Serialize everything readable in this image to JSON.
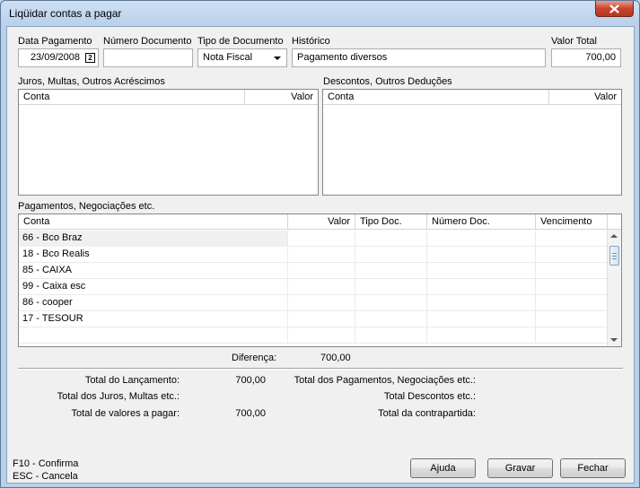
{
  "window": {
    "title": "Liqüidar contas a pagar"
  },
  "header": {
    "data_pagamento_label": "Data Pagamento",
    "data_pagamento_value": "23/09/2008",
    "numero_documento_label": "Número Documento",
    "numero_documento_value": "",
    "tipo_documento_label": "Tipo de Documento",
    "tipo_documento_value": "Nota Fiscal",
    "historico_label": "Histórico",
    "historico_value": "Pagamento diversos",
    "valor_total_label": "Valor Total",
    "valor_total_value": "700,00"
  },
  "acrescimos": {
    "label": "Juros, Multas, Outros Acréscimos",
    "columns": [
      "Conta",
      "Valor"
    ]
  },
  "deducoes": {
    "label": "Descontos, Outros Deduções",
    "columns": [
      "Conta",
      "Valor"
    ]
  },
  "pagamentos": {
    "label": "Pagamentos, Negociações etc.",
    "columns": [
      "Conta",
      "Valor",
      "Tipo Doc.",
      "Número Doc.",
      "Vencimento"
    ],
    "rows": [
      "66 - Bco Braz",
      "18 - Bco Realis",
      "85 - CAIXA",
      "99 - Caixa esc",
      "86 - cooper",
      "17 - TESOUR"
    ]
  },
  "diferenca": {
    "label": "Diferença:",
    "value": "700,00"
  },
  "totais": {
    "total_lancamento_label": "Total do Lançamento:",
    "total_lancamento_value": "700,00",
    "total_juros_label": "Total dos Juros, Multas etc.:",
    "total_juros_value": "",
    "total_pagar_label": "Total de valores a pagar:",
    "total_pagar_value": "700,00",
    "total_pagamentos_label": "Total dos Pagamentos, Negociações etc.:",
    "total_descontos_label": "Total Descontos etc.:",
    "total_contrapartida_label": "Total da contrapartida:"
  },
  "footer": {
    "shortcut_confirma": "F10 - Confirma",
    "shortcut_cancela": "ESC - Cancela",
    "ajuda_label": "Ajuda",
    "gravar_label": "Gravar",
    "fechar_label": "Fechar"
  },
  "calendar_icon_glyph": "2",
  "colors": {
    "title_bg": "#b9d0ea",
    "close_red": "#c7452d",
    "client_bg": "#f0f0f0"
  }
}
